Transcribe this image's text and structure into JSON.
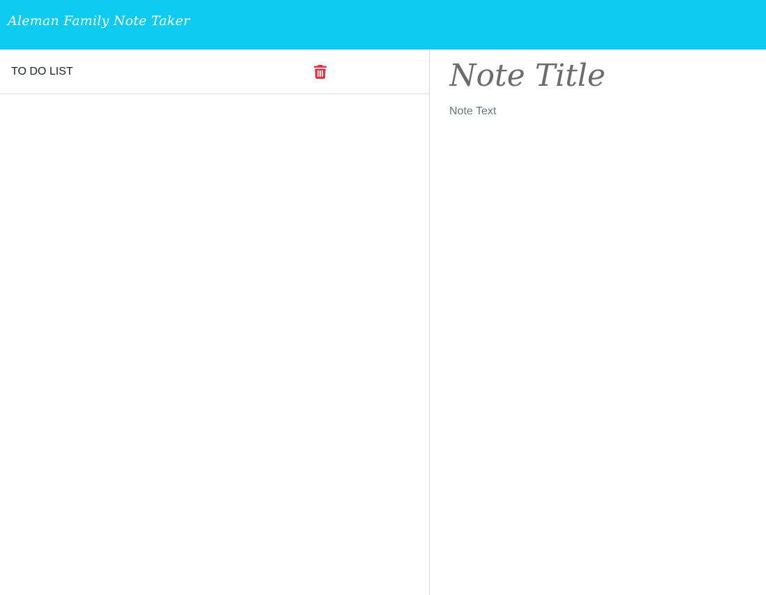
{
  "navbar": {
    "brand": "Aleman Family Note Taker",
    "background_color": "#0dcaf0"
  },
  "notes_list": {
    "items": [
      {
        "title": "TO DO LIST",
        "delete_icon": "trash-icon",
        "delete_icon_color": "#dc3545"
      }
    ]
  },
  "editor": {
    "title_placeholder": "Note Title",
    "text_placeholder": "Note Text"
  }
}
